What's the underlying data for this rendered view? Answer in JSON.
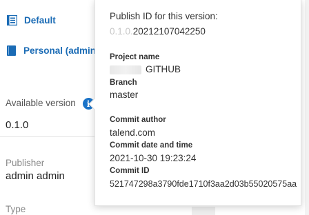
{
  "nav": {
    "default_label": "Default",
    "personal_label": "Personal (admin a"
  },
  "details": {
    "available_version_label": "Available version",
    "version_value": "0.1.0",
    "publisher_label": "Publisher",
    "publisher_value": "admin admin",
    "type_label": "Type"
  },
  "popover": {
    "heading": "Publish ID for this version:",
    "publish_id_prefix": "0.1.0.",
    "publish_id_value": "20212107042250",
    "project_name_label": "Project name",
    "project_name_value": "GITHUB",
    "branch_label": "Branch",
    "branch_value": "master",
    "commit_author_label": "Commit author",
    "commit_author_value": "talend.com",
    "commit_date_label": "Commit date and time",
    "commit_date_value": "2021-10-30 19:23:24",
    "commit_id_label": "Commit ID",
    "commit_id_value": "521747298a3790fde1710f3aa2d03b55020575aa"
  },
  "colors": {
    "link": "#1a6bb5",
    "info_icon": "#1a73c8",
    "muted_prefix": "#c8c8c8"
  },
  "icons": {
    "default": "list-icon",
    "personal": "book-icon",
    "info": "info-icon"
  }
}
